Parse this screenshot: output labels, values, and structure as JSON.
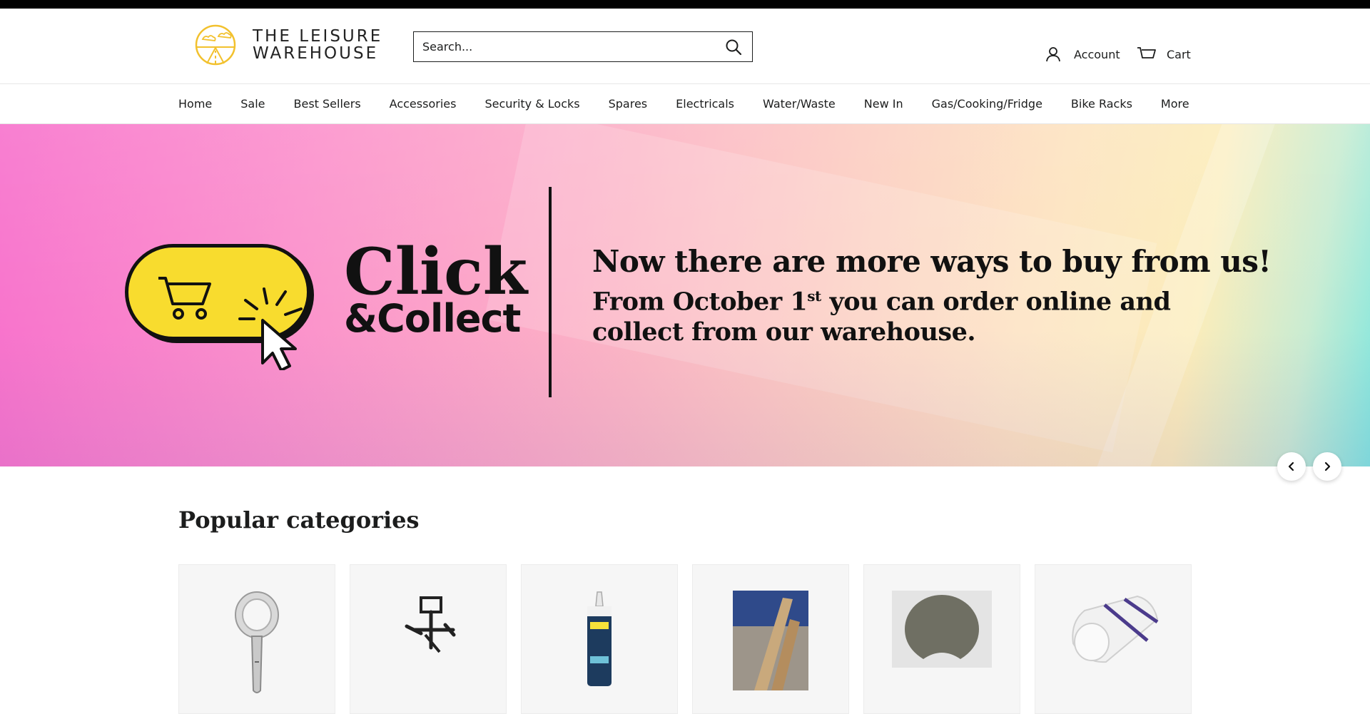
{
  "brand": {
    "line1": "THE LEISURE",
    "line2": "WAREHOUSE",
    "logo_color": "#f2c12e"
  },
  "search": {
    "placeholder": "Search...",
    "value": ""
  },
  "header": {
    "account_label": "Account",
    "cart_label": "Cart"
  },
  "nav": {
    "items": [
      "Home",
      "Sale",
      "Best Sellers",
      "Accessories",
      "Security & Locks",
      "Spares",
      "Electricals",
      "Water/Waste",
      "New In",
      "Gas/Cooking/Fridge",
      "Bike Racks",
      "More"
    ]
  },
  "hero": {
    "click": "Click",
    "collect": "&Collect",
    "heading": "Now there are more ways to buy from us!",
    "sub_part1": "From October 1",
    "sub_sup": "st",
    "sub_part2": " you can order online and collect from our warehouse.",
    "pill_color": "#f8dc2e"
  },
  "carousel": {
    "prev_icon": "chevron-left-icon",
    "next_icon": "chevron-right-icon"
  },
  "categories": {
    "title": "Popular categories",
    "items": [
      {
        "icon": "shower-head"
      },
      {
        "icon": "bike-rack"
      },
      {
        "icon": "sealant-tube"
      },
      {
        "icon": "wood-trim"
      },
      {
        "icon": "grey-plate"
      },
      {
        "icon": "rolled-mattress"
      }
    ]
  }
}
